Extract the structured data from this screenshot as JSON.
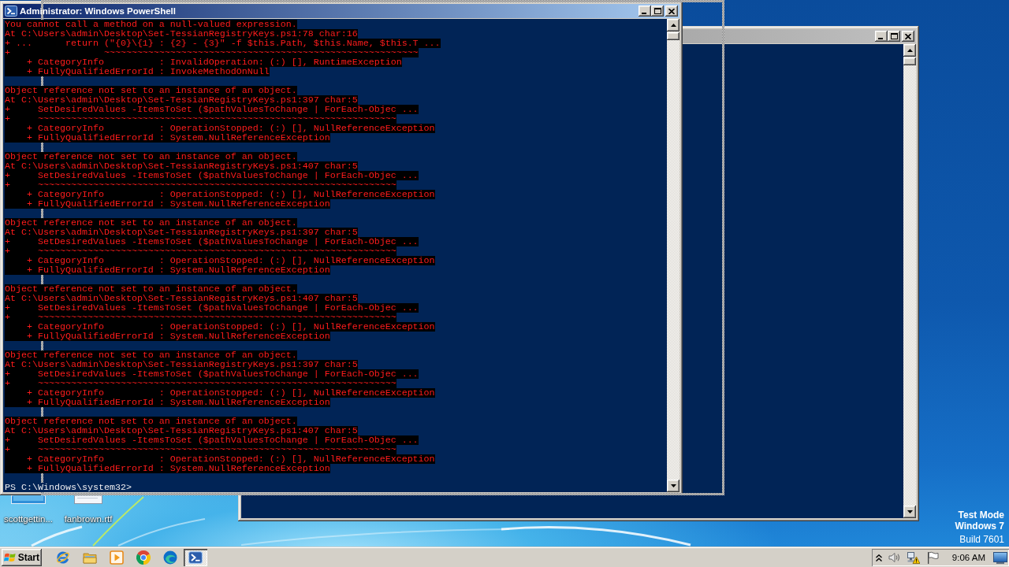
{
  "console_window": {
    "title": "Administrator: Windows PowerShell",
    "active": true,
    "output": [
      {
        "lines": [
          "You cannot call a method on a null-valued expression.",
          "At C:\\Users\\admin\\Desktop\\Set-TessianRegistryKeys.ps1:78 char:16",
          "+ ...      return (\"{0}\\{1} : {2} - {3}\" -f $this.Path, $this.Name, $this.T ...",
          "+                 ~~~~~~~~~~~~~~~~~~~~~~~~~~~~~~~~~~~~~~~~~~~~~~~~~~~~~~~~~",
          "    + CategoryInfo          : InvalidOperation: (:) [], RuntimeException",
          "    + FullyQualifiedErrorId : InvokeMethodOnNull"
        ]
      },
      {
        "lines": [
          "Object reference not set to an instance of an object.",
          "At C:\\Users\\admin\\Desktop\\Set-TessianRegistryKeys.ps1:397 char:5",
          "+     SetDesiredValues -ItemsToSet ($pathValuesToChange | ForEach-Objec ...",
          "+     ~~~~~~~~~~~~~~~~~~~~~~~~~~~~~~~~~~~~~~~~~~~~~~~~~~~~~~~~~~~~~~~~~",
          "    + CategoryInfo          : OperationStopped: (:) [], NullReferenceException",
          "    + FullyQualifiedErrorId : System.NullReferenceException"
        ]
      },
      {
        "lines": [
          "Object reference not set to an instance of an object.",
          "At C:\\Users\\admin\\Desktop\\Set-TessianRegistryKeys.ps1:407 char:5",
          "+     SetDesiredValues -ItemsToSet ($pathValuesToChange | ForEach-Objec ...",
          "+     ~~~~~~~~~~~~~~~~~~~~~~~~~~~~~~~~~~~~~~~~~~~~~~~~~~~~~~~~~~~~~~~~~",
          "    + CategoryInfo          : OperationStopped: (:) [], NullReferenceException",
          "    + FullyQualifiedErrorId : System.NullReferenceException"
        ]
      },
      {
        "lines": [
          "Object reference not set to an instance of an object.",
          "At C:\\Users\\admin\\Desktop\\Set-TessianRegistryKeys.ps1:397 char:5",
          "+     SetDesiredValues -ItemsToSet ($pathValuesToChange | ForEach-Objec ...",
          "+     ~~~~~~~~~~~~~~~~~~~~~~~~~~~~~~~~~~~~~~~~~~~~~~~~~~~~~~~~~~~~~~~~~",
          "    + CategoryInfo          : OperationStopped: (:) [], NullReferenceException",
          "    + FullyQualifiedErrorId : System.NullReferenceException"
        ]
      },
      {
        "lines": [
          "Object reference not set to an instance of an object.",
          "At C:\\Users\\admin\\Desktop\\Set-TessianRegistryKeys.ps1:407 char:5",
          "+     SetDesiredValues -ItemsToSet ($pathValuesToChange | ForEach-Objec ...",
          "+     ~~~~~~~~~~~~~~~~~~~~~~~~~~~~~~~~~~~~~~~~~~~~~~~~~~~~~~~~~~~~~~~~~",
          "    + CategoryInfo          : OperationStopped: (:) [], NullReferenceException",
          "    + FullyQualifiedErrorId : System.NullReferenceException"
        ]
      },
      {
        "lines": [
          "Object reference not set to an instance of an object.",
          "At C:\\Users\\admin\\Desktop\\Set-TessianRegistryKeys.ps1:397 char:5",
          "+     SetDesiredValues -ItemsToSet ($pathValuesToChange | ForEach-Objec ...",
          "+     ~~~~~~~~~~~~~~~~~~~~~~~~~~~~~~~~~~~~~~~~~~~~~~~~~~~~~~~~~~~~~~~~~",
          "    + CategoryInfo          : OperationStopped: (:) [], NullReferenceException",
          "    + FullyQualifiedErrorId : System.NullReferenceException"
        ]
      },
      {
        "lines": [
          "Object reference not set to an instance of an object.",
          "At C:\\Users\\admin\\Desktop\\Set-TessianRegistryKeys.ps1:407 char:5",
          "+     SetDesiredValues -ItemsToSet ($pathValuesToChange | ForEach-Objec ...",
          "+     ~~~~~~~~~~~~~~~~~~~~~~~~~~~~~~~~~~~~~~~~~~~~~~~~~~~~~~~~~~~~~~~~~",
          "    + CategoryInfo          : OperationStopped: (:) [], NullReferenceException",
          "    + FullyQualifiedErrorId : System.NullReferenceException"
        ]
      }
    ],
    "prompt": "PS C:\\Windows\\system32>"
  },
  "background_window": {
    "active": false
  },
  "desktop_icons": [
    {
      "label": "scottgettin...",
      "kind": "image"
    },
    {
      "label": "fanbrown.rtf",
      "kind": "document"
    }
  ],
  "os_notice": {
    "mode": "Test Mode",
    "edition": "Windows 7",
    "build": "Build 7601"
  },
  "taskbar": {
    "start_label": "Start",
    "items": [
      {
        "kind": "ie",
        "selected": false
      },
      {
        "kind": "explorer",
        "selected": false
      },
      {
        "kind": "media",
        "selected": false
      },
      {
        "kind": "chrome",
        "selected": false
      },
      {
        "kind": "edge",
        "selected": false
      },
      {
        "kind": "powershell",
        "selected": true
      }
    ],
    "clock": "9:06 AM"
  }
}
